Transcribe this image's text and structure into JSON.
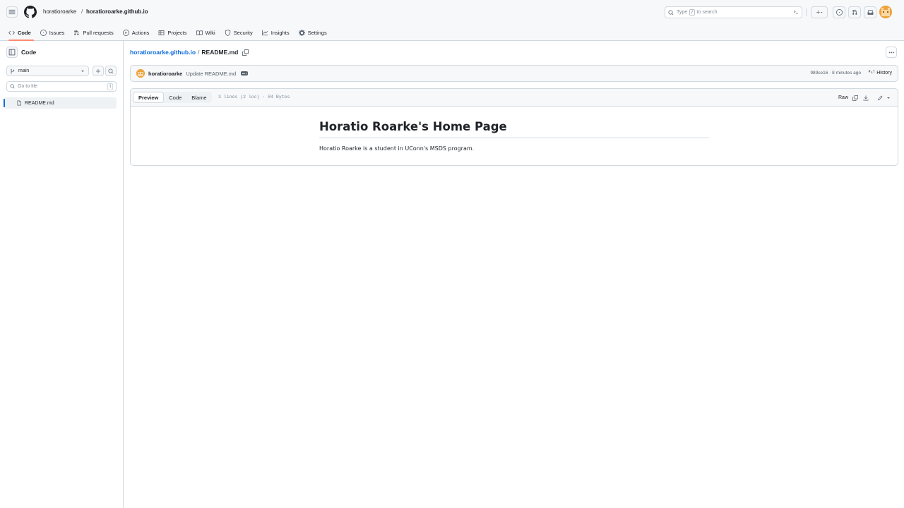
{
  "header": {
    "owner": "horatioroarke",
    "separator": "/",
    "repo": "horatioroarke.github.io",
    "search": {
      "prefix": "Type",
      "key": "/",
      "suffix": "to search"
    }
  },
  "repo_nav": {
    "tabs": [
      {
        "label": "Code",
        "icon": "code-icon",
        "active": true
      },
      {
        "label": "Issues",
        "icon": "issue-opened-icon"
      },
      {
        "label": "Pull requests",
        "icon": "git-pull-request-icon"
      },
      {
        "label": "Actions",
        "icon": "play-icon"
      },
      {
        "label": "Projects",
        "icon": "table-icon"
      },
      {
        "label": "Wiki",
        "icon": "book-icon"
      },
      {
        "label": "Security",
        "icon": "shield-icon"
      },
      {
        "label": "Insights",
        "icon": "graph-icon"
      },
      {
        "label": "Settings",
        "icon": "gear-icon"
      }
    ]
  },
  "sidebar": {
    "title": "Code",
    "branch": "main",
    "goto_placeholder": "Go to file",
    "goto_key": "t",
    "files": [
      {
        "name": "README.md",
        "selected": true
      }
    ]
  },
  "file": {
    "repo": "horatioroarke.github.io",
    "separator": "/",
    "name": "README.md"
  },
  "commit": {
    "author": "horatioroarke",
    "message": "Update README.md",
    "meta": "989ce16 · 8 minutes ago",
    "history_label": "History"
  },
  "viewer": {
    "tabs": [
      "Preview",
      "Code",
      "Blame"
    ],
    "active_tab": "Preview",
    "info": "3 lines (2 loc) · 84 Bytes",
    "raw_label": "Raw"
  },
  "readme": {
    "heading": "Horatio Roarke's Home Page",
    "body": "Horatio Roarke is a student in UConn's MSDS program."
  },
  "colors": {
    "accent_link": "#0969da",
    "active_tab_underline": "#fd8c73",
    "avatar": "#f0a33d"
  }
}
